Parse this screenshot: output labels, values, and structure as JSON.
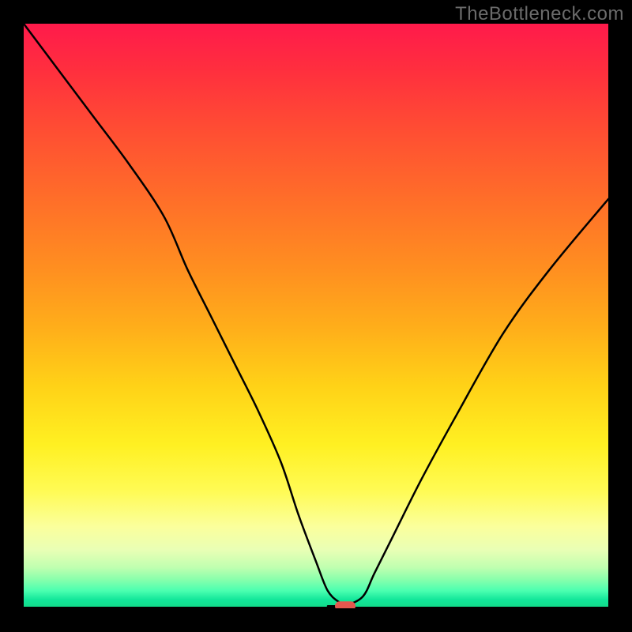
{
  "watermark": "TheBottleneck.com",
  "chart_data": {
    "type": "line",
    "title": "",
    "xlabel": "",
    "ylabel": "",
    "xlim": [
      0,
      100
    ],
    "ylim": [
      0,
      100
    ],
    "x": [
      0,
      6,
      12,
      18,
      24,
      28,
      32,
      36,
      40,
      44,
      47,
      50,
      52,
      54,
      55,
      58,
      60,
      63,
      68,
      74,
      82,
      90,
      100
    ],
    "values": [
      100,
      92,
      84,
      76,
      67,
      58,
      50,
      42,
      34,
      25,
      16,
      8,
      3,
      1,
      0.5,
      2,
      6,
      12,
      22,
      33,
      47,
      58,
      70
    ],
    "annotations": [
      {
        "name": "minimum-marker",
        "x": 55,
        "y": 0.5
      }
    ],
    "gradient_stops": [
      {
        "pos": 0,
        "color": "#ff1a4b"
      },
      {
        "pos": 0.3,
        "color": "#ff6e29"
      },
      {
        "pos": 0.62,
        "color": "#ffd217"
      },
      {
        "pos": 0.8,
        "color": "#fffb55"
      },
      {
        "pos": 0.95,
        "color": "#8affac"
      },
      {
        "pos": 1.0,
        "color": "#11d987"
      }
    ]
  }
}
